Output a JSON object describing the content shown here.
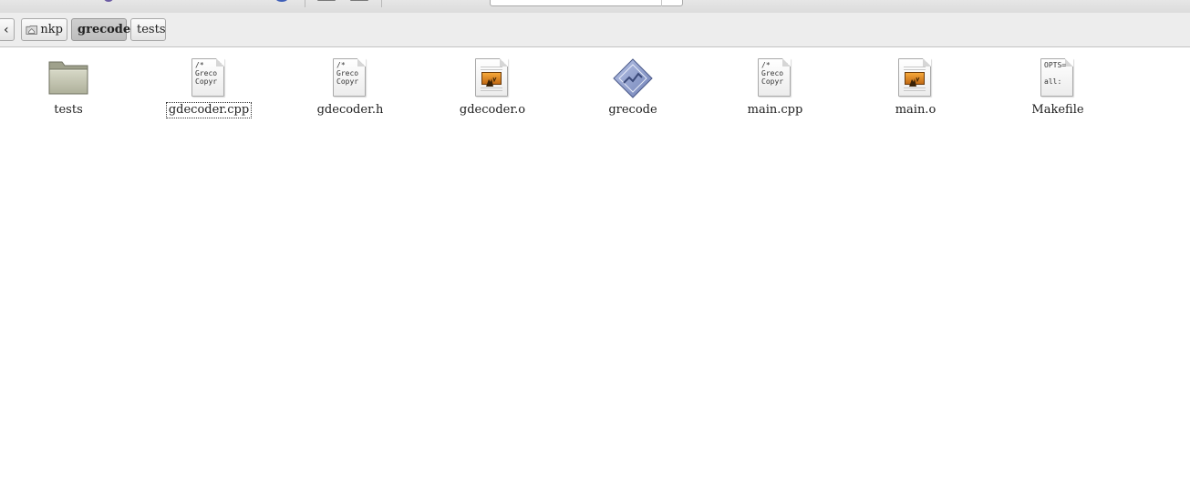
{
  "pathbar": {
    "back_label": "‹",
    "crumbs": [
      "nkp",
      "grecode",
      "tests"
    ]
  },
  "files": [
    {
      "name": "tests",
      "kind": "folder"
    },
    {
      "name": "gdecoder.cpp",
      "kind": "source",
      "preview": "/*\nGreco\nCopyr"
    },
    {
      "name": "gdecoder.h",
      "kind": "source",
      "preview": "/*\nGreco\nCopyr"
    },
    {
      "name": "gdecoder.o",
      "kind": "object"
    },
    {
      "name": "grecode",
      "kind": "executable"
    },
    {
      "name": "main.cpp",
      "kind": "source",
      "preview": "/*\nGreco\nCopyr"
    },
    {
      "name": "main.o",
      "kind": "object"
    },
    {
      "name": "Makefile",
      "kind": "makefile",
      "preview": "OPTS=\n\nall:"
    }
  ],
  "colors": {
    "folder": "#c9cab6",
    "executable": "#8f9fcf",
    "pathbar_bg": "#ededed"
  }
}
